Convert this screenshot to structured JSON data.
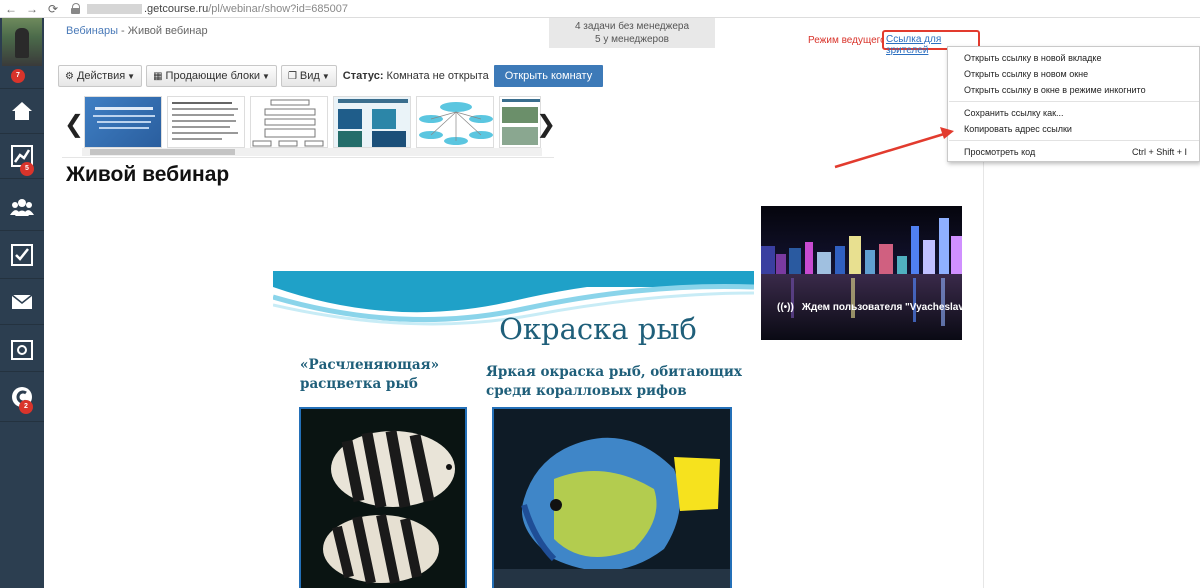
{
  "browser": {
    "url_domain": ".getcourse.ru",
    "url_path": "/pl/webinar/show?id=685007"
  },
  "sidebar": {
    "items": [
      {
        "name": "avatar",
        "badge": "7"
      },
      {
        "name": "home-icon",
        "badge": ""
      },
      {
        "name": "chart-icon",
        "badge": "5"
      },
      {
        "name": "users-icon",
        "badge": ""
      },
      {
        "name": "tasks-icon",
        "badge": ""
      },
      {
        "name": "mail-icon",
        "badge": ""
      },
      {
        "name": "safe-icon",
        "badge": ""
      },
      {
        "name": "getcourse-logo-icon",
        "badge": "2"
      }
    ]
  },
  "header": {
    "breadcrumb_root": "Вебинары",
    "breadcrumb_sep": " - ",
    "breadcrumb_current": "Живой вебинар",
    "tasks_line1": "4 задачи без менеджера",
    "tasks_line2": "5 у менеджеров",
    "host_mode": "Режим ведущего",
    "viewer_link": "Ссылка для зрителей"
  },
  "toolbar": {
    "actions": "Действия",
    "selling_blocks": "Продающие блоки",
    "view": "Вид",
    "status_label": "Статус:",
    "status_value": "Комната не открыта",
    "open_room": "Открыть комнату"
  },
  "page_title": "Живой вебинар",
  "video": {
    "waiting_text": "Ждем пользователя \"Vyacheslav"
  },
  "slide": {
    "title": "Окраска рыб",
    "caption_left_1": "«Расчленяющая»",
    "caption_left_2": "расцветка рыб",
    "caption_right_1": "Яркая окраска рыб, обитающих",
    "caption_right_2": "среди коралловых рифов"
  },
  "context_menu": {
    "open_new_tab": "Открыть ссылку в новой вкладке",
    "open_new_window": "Открыть ссылку в новом окне",
    "open_incognito": "Открыть ссылку в окне в режиме инкогнито",
    "save_link": "Сохранить ссылку как...",
    "copy_link": "Копировать адрес ссылки",
    "inspect": "Просмотреть код",
    "inspect_shortcut": "Ctrl + Shift + I"
  },
  "colors": {
    "sidebar": "#2c3e50",
    "badge": "#d9342b",
    "primary_button": "#3d7ab8",
    "highlight": "#e23b2e"
  }
}
